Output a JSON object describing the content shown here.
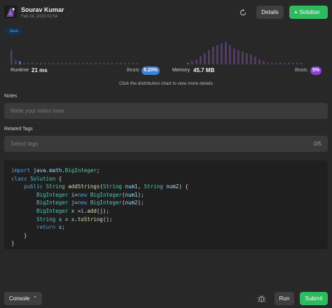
{
  "header": {
    "user_name": "Sourav Kumar",
    "date": "Feb 24, 2023 01:54",
    "avatar_icon": "avatar-image",
    "share_icon": "share-icon",
    "details_label": "Details",
    "solution_label": "Solution"
  },
  "language_tag": "Java",
  "stats": {
    "runtime_label": "Runtime",
    "runtime_value": "21 ms",
    "runtime_beats_label": "Beats",
    "runtime_beats_value": "8.20%",
    "memory_label": "Memory",
    "memory_value": "45.7 MB",
    "memory_beats_label": "Beats",
    "memory_beats_value": "5%"
  },
  "distribution_hint": "Click the distribution chart to view more details",
  "notes": {
    "label": "Notes",
    "placeholder": "Write your notes here"
  },
  "tags": {
    "label": "Related Tags",
    "placeholder": "Select tags",
    "count": "0/5"
  },
  "code_lines": [
    "import java.math.BigInteger;",
    "class Solution {",
    "    public String addStrings(String num1, String num2) {",
    "        BigInteger i=new BigInteger(num1);",
    "        BigInteger j=new BigInteger(num2);",
    "        BigInteger x =i.add(j);",
    "        String s = x.toString();",
    "        return s;",
    "    }",
    "}"
  ],
  "footer": {
    "console_label": "Console",
    "run_label": "Run",
    "submit_label": "Submit"
  },
  "colors": {
    "accent_green": "#2cbb5d",
    "runtime_blue": "#3b82d6",
    "memory_purple": "#8c3fd6"
  },
  "chart_data": {
    "type": "bar",
    "series": [
      {
        "values": [
          9,
          3,
          2,
          1,
          1,
          1,
          1,
          1,
          1,
          1,
          1,
          1,
          1,
          1,
          1,
          1,
          1,
          1,
          1,
          1,
          1,
          1,
          1,
          1,
          1,
          1,
          1,
          1,
          1,
          1,
          1
        ],
        "highlight_index": 2
      },
      {
        "values": [
          1,
          2,
          3,
          5,
          7,
          9,
          11,
          12,
          13,
          14,
          12,
          10,
          9,
          8,
          7,
          6,
          5,
          3,
          2,
          1,
          1,
          1,
          1,
          1,
          1,
          1,
          1,
          1
        ],
        "highlight_index": 0
      }
    ]
  }
}
